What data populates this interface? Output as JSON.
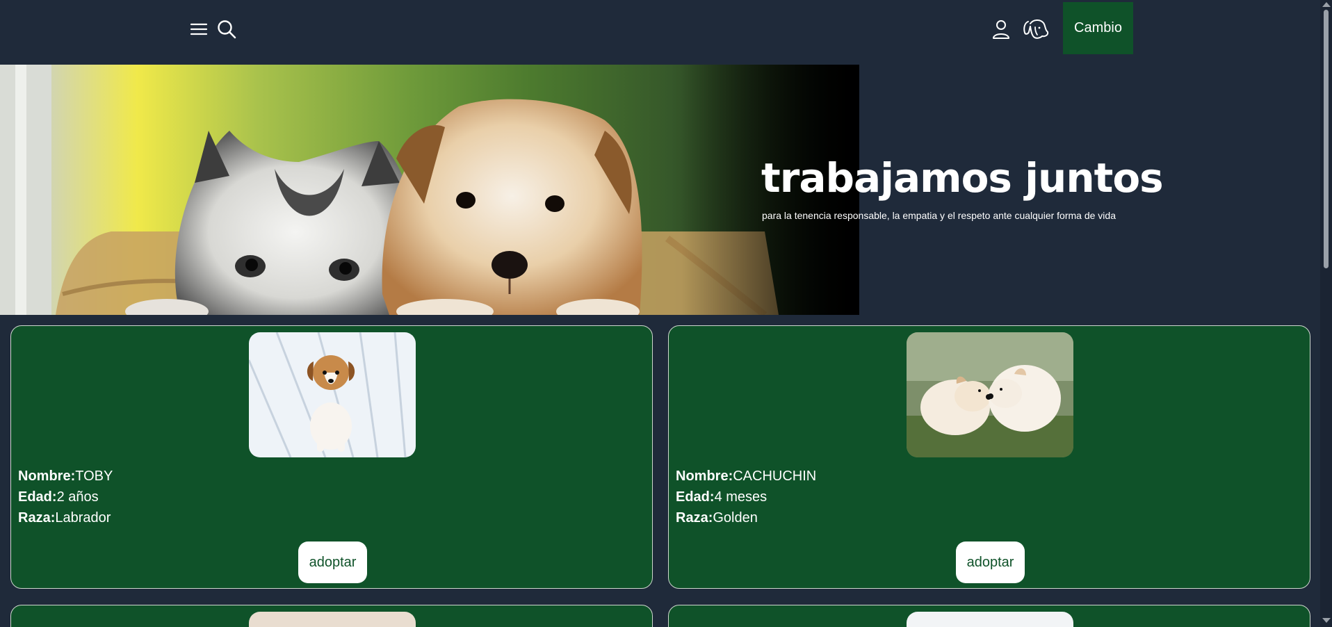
{
  "header": {
    "menu_icon": "hamburger-menu-icon",
    "search_icon": "search-icon",
    "user_icon": "user-icon",
    "dog_icon": "dog-head-icon",
    "cambio_label": "Cambio"
  },
  "hero": {
    "title": "trabajamos juntos",
    "subtitle": "para la tenencia responsable, la empatia y el respeto ante cualquier forma de vida"
  },
  "pets": [
    {
      "nombre_label": "Nombre:",
      "nombre": "TOBY",
      "edad_label": "Edad:",
      "edad": "2 años",
      "raza_label": "Raza:",
      "raza": "Labrador",
      "button": "adoptar"
    },
    {
      "nombre_label": "Nombre:",
      "nombre": "CACHUCHIN",
      "edad_label": "Edad:",
      "edad": "4 meses",
      "raza_label": "Raza:",
      "raza": "Golden",
      "button": "adoptar"
    }
  ],
  "colors": {
    "page_bg": "#1f2a3a",
    "card_bg": "#0f5229",
    "accent": "#0f5229",
    "text": "#ffffff"
  }
}
